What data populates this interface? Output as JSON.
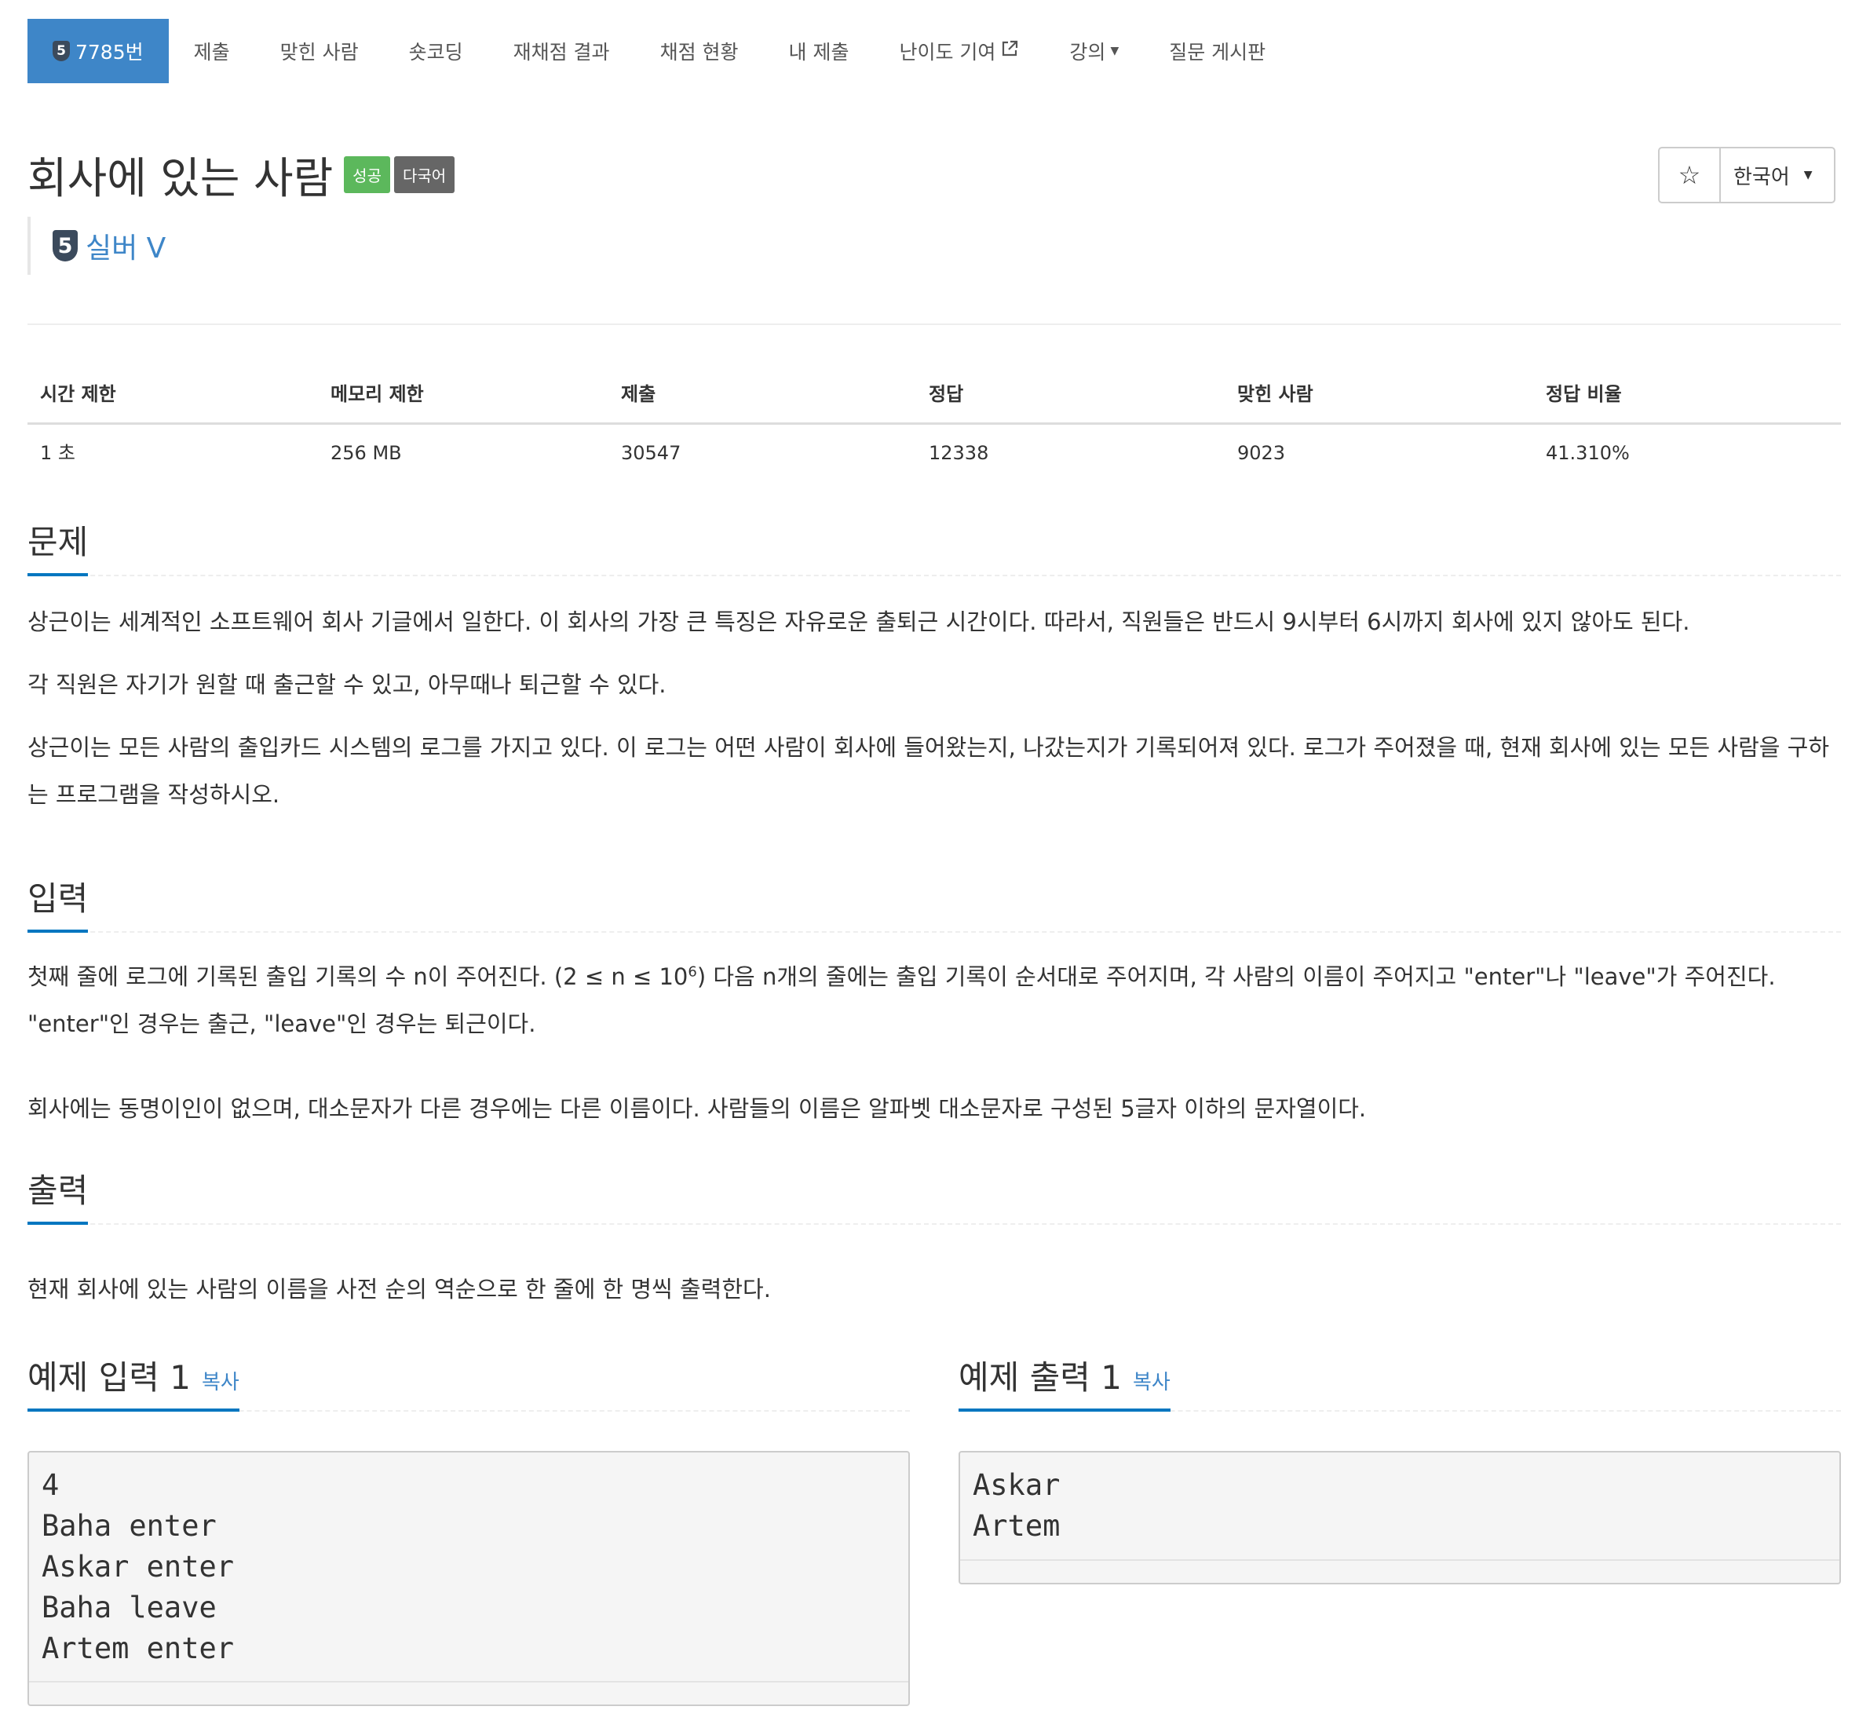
{
  "nav": {
    "tier_badge": "5",
    "items": [
      "7785번",
      "제출",
      "맞힌 사람",
      "숏코딩",
      "재채점 결과",
      "채점 현황",
      "내 제출",
      "난이도 기여",
      "강의",
      "질문 게시판"
    ]
  },
  "problem": {
    "title": "회사에 있는 사람",
    "labels": [
      "성공",
      "다국어"
    ],
    "tier_number": "5",
    "tier": "실버 V"
  },
  "controls": {
    "star": "☆",
    "language": "한국어"
  },
  "stats": {
    "headers": [
      "시간 제한",
      "메모리 제한",
      "제출",
      "정답",
      "맞힌 사람",
      "정답 비율"
    ],
    "values": [
      "1 초",
      "256 MB",
      "30547",
      "12338",
      "9023",
      "41.310%"
    ]
  },
  "description": {
    "title": "문제",
    "paragraphs": [
      "상근이는 세계적인 소프트웨어 회사 기글에서 일한다. 이 회사의 가장 큰 특징은 자유로운 출퇴근 시간이다. 따라서, 직원들은 반드시 9시부터 6시까지 회사에 있지 않아도 된다.",
      "각 직원은 자기가 원할 때 출근할 수 있고, 아무때나 퇴근할 수 있다.",
      "상근이는 모든 사람의 출입카드 시스템의 로그를 가지고 있다. 이 로그는 어떤 사람이 회사에 들어왔는지, 나갔는지가 기록되어져 있다. 로그가 주어졌을 때, 현재 회사에 있는 모든 사람을 구하는 프로그램을 작성하시오."
    ]
  },
  "input": {
    "title": "입력",
    "p1_a": "첫째 줄에 로그에 기록된 출입 기록의 수 n이 주어진다. (2 ≤ n ≤ 10",
    "p1_sup": "6",
    "p1_b": ") 다음 n개의 줄에는 출입 기록이 순서대로 주어지며, 각 사람의 이름이 주어지고 \"enter\"나 \"leave\"가 주어진다. \"enter\"인 경우는 출근, \"leave\"인 경우는 퇴근이다.",
    "p2": "회사에는 동명이인이 없으며, 대소문자가 다른 경우에는 다른 이름이다. 사람들의 이름은 알파벳 대소문자로 구성된 5글자 이하의 문자열이다."
  },
  "output": {
    "title": "출력",
    "p1": "현재 회사에 있는 사람의 이름을 사전 순의 역순으로 한 줄에 한 명씩 출력한다."
  },
  "samples": {
    "input_title": "예제 입력 1",
    "output_title": "예제 출력 1",
    "copy_label": "복사",
    "input": "4\nBaha enter\nAskar enter\nBaha leave\nArtem enter",
    "output": "Askar\nArtem"
  }
}
